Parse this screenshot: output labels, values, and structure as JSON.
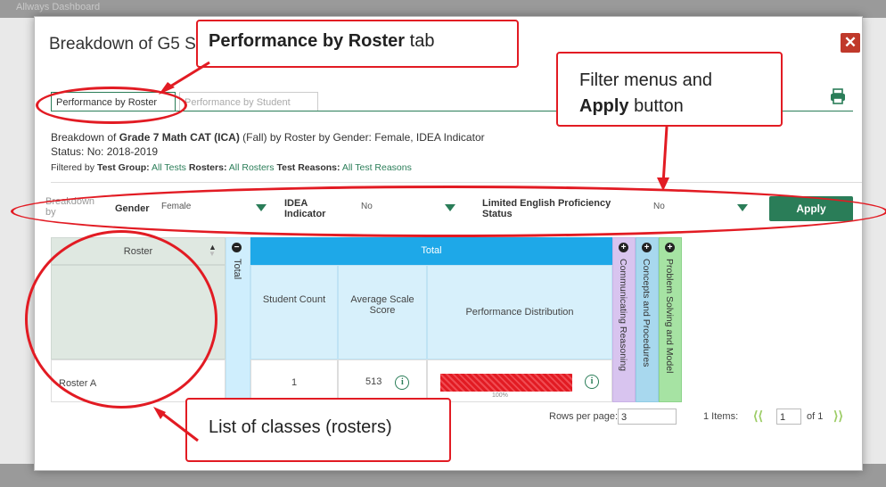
{
  "background": {
    "title": "Allways Dashboard"
  },
  "modal": {
    "title": "Breakdown of G5 S",
    "close_icon": "close-icon",
    "print_icon": "printer-icon"
  },
  "tabs": [
    {
      "label": "Performance by Roster",
      "active": true
    },
    {
      "label": "Performance by Student",
      "active": false
    }
  ],
  "description": {
    "prefix": "Breakdown of ",
    "assessment": "Grade 7 Math CAT (ICA)",
    "suffix": " (Fall) by Roster by Gender: Female, IDEA Indicator",
    "status": "Status: No: 2018-2019",
    "filtered_prefix": "Filtered by ",
    "filters": [
      {
        "label": "Test Group:",
        "value": "All Tests"
      },
      {
        "label": "Rosters:",
        "value": "All Rosters"
      },
      {
        "label": "Test Reasons:",
        "value": "All Test Reasons"
      }
    ]
  },
  "filter_bar": {
    "breakdown_by": "Breakdown by",
    "gender_label": "Gender",
    "gender_value": "Female",
    "idea_label": "IDEA Indicator",
    "idea_value": "No",
    "lep_label": "Limited English Proficiency Status",
    "lep_value": "No",
    "apply_label": "Apply"
  },
  "table": {
    "roster_header": "Roster",
    "total_vertical": "Total",
    "total_header": "Total",
    "student_count_header": "Student Count",
    "avg_scale_header": "Average Scale Score",
    "perf_dist_header": "Performance Distribution",
    "claims": [
      "Communicating Reasoning",
      "Concepts and Procedures",
      "Problem Solving and Model"
    ],
    "rows": [
      {
        "roster": "Roster A",
        "student_count": "1",
        "avg_scale_score": "513",
        "perf_percent": "100%"
      }
    ]
  },
  "pagination": {
    "rows_per_page_label": "Rows per page:",
    "rows_per_page_value": "3",
    "items_label": "1 Items:",
    "page_value": "1",
    "of_label": "of 1"
  },
  "callouts": {
    "roster_tab_bold": "Performance by Roster",
    "roster_tab_rest": " tab",
    "filter_line1": "Filter menus and",
    "filter_bold": "Apply",
    "filter_rest": " button",
    "list_label": "List of classes (rosters)"
  },
  "colors": {
    "accent_green": "#2a7d58",
    "total_blue": "#1ea8e8",
    "claim_purple": "#d8c4ef",
    "claim_blue": "#a8d8ee",
    "claim_green": "#a6e3a3",
    "callout_red": "#e21b23"
  }
}
